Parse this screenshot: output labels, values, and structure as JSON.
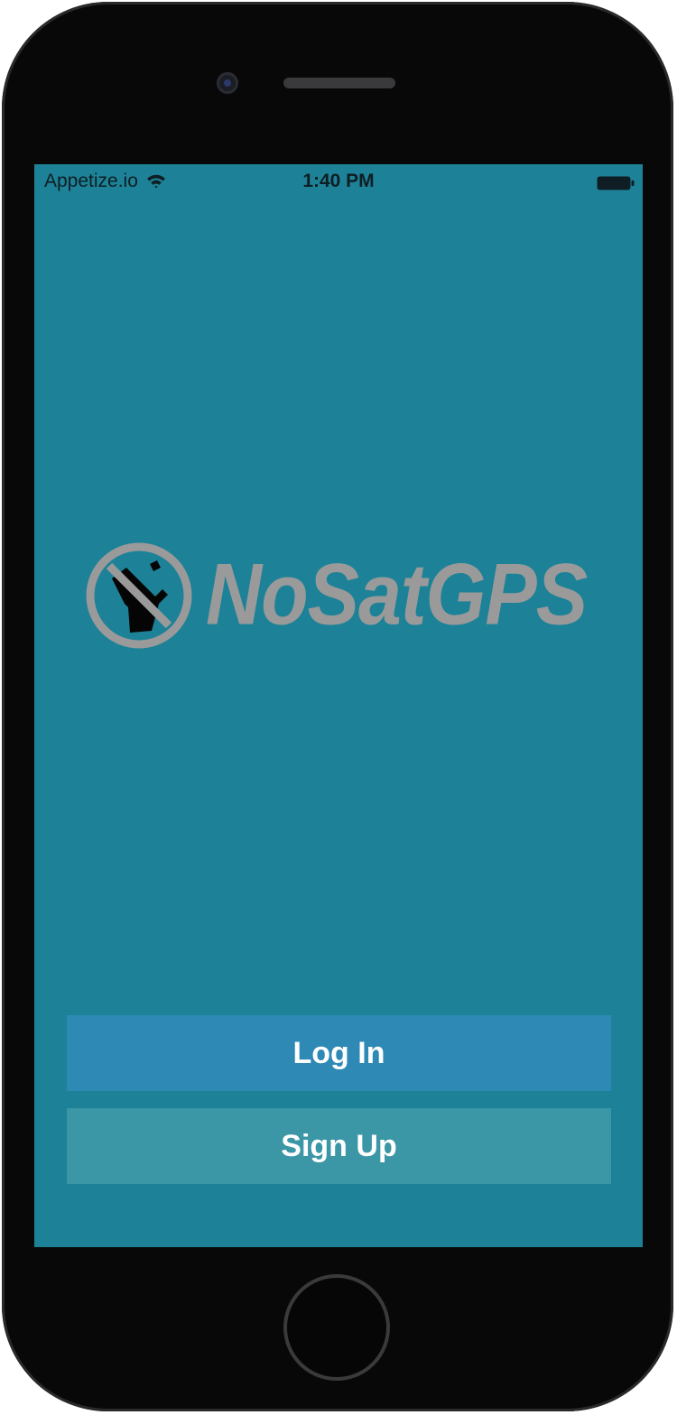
{
  "status_bar": {
    "carrier": "Appetize.io",
    "time": "1:40 PM",
    "wifi_icon": "wifi-icon",
    "battery_icon": "battery-full-icon"
  },
  "logo": {
    "text": "NoSatGPS",
    "icon": "no-satellite-icon"
  },
  "buttons": {
    "login_label": "Log In",
    "signup_label": "Sign Up"
  },
  "colors": {
    "screen_background": "#1d8297",
    "login_button": "#2f89b5",
    "signup_button": "#3b96a5",
    "logo_gray": "#9a9a9a",
    "phone_body": "#080808"
  }
}
